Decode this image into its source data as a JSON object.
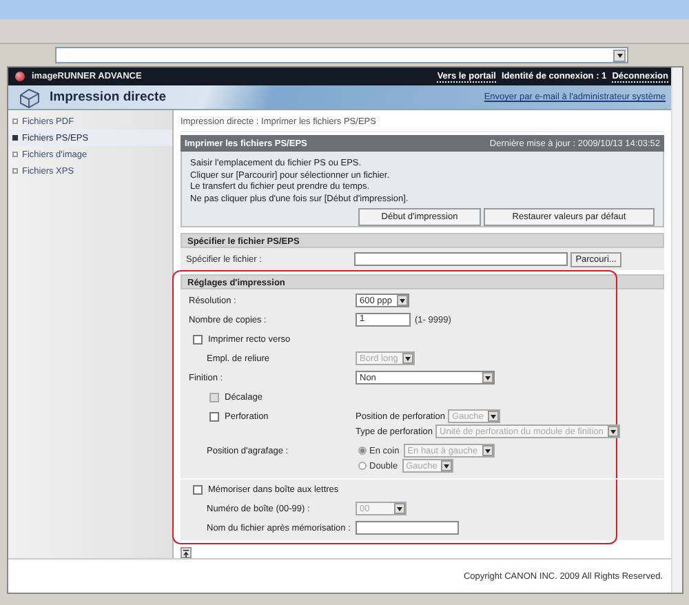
{
  "header": {
    "product": "imageRUNNER ADVANCE",
    "portal_link": "Vers le portail",
    "login_label": "Identité de connexion : 1",
    "logout_link": "Déconnexion"
  },
  "banner": {
    "title": "Impression directe",
    "mail_link": "Envoyer par e-mail à l'administrateur système"
  },
  "sidebar": {
    "items": [
      {
        "label": "Fichiers PDF",
        "selected": false
      },
      {
        "label": "Fichiers PS/EPS",
        "selected": true
      },
      {
        "label": "Fichiers d'image",
        "selected": false
      },
      {
        "label": "Fichiers XPS",
        "selected": false
      }
    ]
  },
  "breadcrumb": "Impression directe : Imprimer les fichiers PS/EPS",
  "panel": {
    "title": "Imprimer les fichiers PS/EPS",
    "updated": "Dernière mise à jour : 2009/10/13 14:03:52",
    "instructions": [
      "Saisir l'emplacement du fichier PS ou EPS.",
      "Cliquer sur [Parcourir] pour sélectionner un fichier.",
      "Le transfert du fichier peut prendre du temps.",
      "Ne pas cliquer plus d'une fois sur [Début d'impression]."
    ],
    "buttons": [
      "Début d'impression",
      "Restaurer valeurs par défaut"
    ]
  },
  "file_section": {
    "title": "Spécifier le fichier PS/EPS",
    "label": "Spécifier le fichier :",
    "browse_button": "Parcouri..."
  },
  "settings": {
    "title": "Réglages d'impression",
    "highlighted": true,
    "rows": [
      {
        "kind": "select",
        "label": "Résolution :",
        "value": "600 ppp",
        "disabled": false
      },
      {
        "kind": "number",
        "label": "Nombre de copies :",
        "value": "1",
        "hint": "(1- 9999)"
      },
      {
        "kind": "checkbox",
        "label": "Imprimer recto verso",
        "checked": false,
        "disabled": false,
        "children": [
          {
            "kind": "select",
            "label": "Empl. de reliure",
            "value": "Bord long",
            "disabled": true
          }
        ]
      },
      {
        "kind": "select",
        "label": "Finition :",
        "value": "Non",
        "disabled": false,
        "wide": true,
        "children": [
          {
            "kind": "checkbox",
            "label": "Décalage",
            "checked": false,
            "disabled": true
          },
          {
            "kind": "checkbox",
            "label": "Perforation",
            "checked": false,
            "disabled": false,
            "fields": [
              {
                "label": "Position de perforation",
                "value": "Gauche",
                "disabled": true
              },
              {
                "label": "Type de perforation",
                "value": "Unité de perforation du module de finition",
                "disabled": true
              }
            ]
          },
          {
            "kind": "radio_group",
            "label": "Position d'agrafage :",
            "options": [
              {
                "label": "En coin",
                "selected": true,
                "value": "En haut à gauche",
                "disabled": true
              },
              {
                "label": "Double",
                "selected": false,
                "value": "Gauche",
                "disabled": true
              }
            ]
          }
        ]
      },
      {
        "kind": "checkbox",
        "label": "Mémoriser dans boîte aux lettres",
        "checked": false,
        "disabled": false,
        "separated": true,
        "children": [
          {
            "kind": "select",
            "label": "Numéro de boîte (00-99) :",
            "value": "00",
            "disabled": true
          },
          {
            "kind": "text",
            "label": "Nom du fichier après mémorisation :"
          }
        ]
      }
    ]
  },
  "footer": {
    "copyright": "Copyright CANON INC. 2009 All Rights Reserved."
  }
}
